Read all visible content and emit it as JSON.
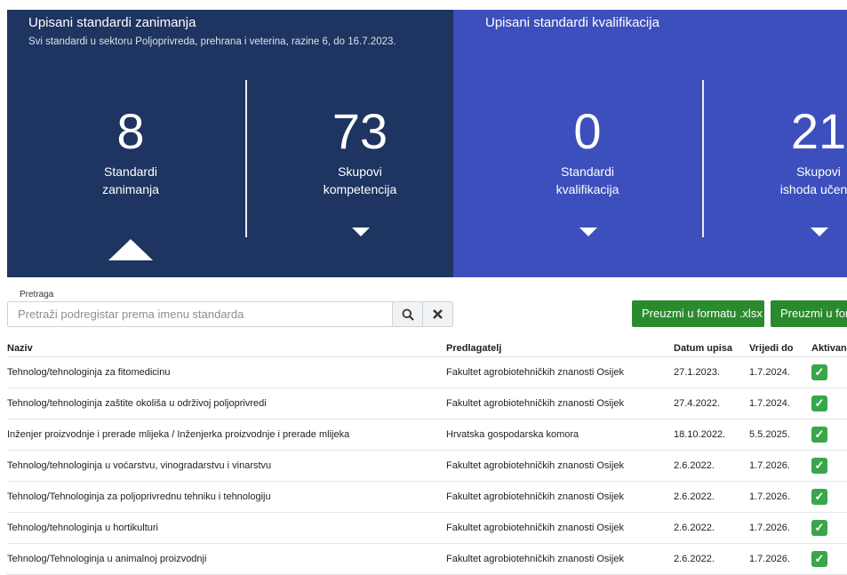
{
  "left_panel": {
    "title": "Upisani standardi zanimanja",
    "subtitle": "Svi standardi u sektoru Poljoprivreda, prehrana i veterina, razine 6, do 16.7.2023.",
    "stats": [
      {
        "value": "8",
        "label_line1": "Standardi",
        "label_line2": "zanimanja"
      },
      {
        "value": "73",
        "label_line1": "Skupovi",
        "label_line2": "kompetencija"
      }
    ]
  },
  "right_panel": {
    "title": "Upisani standardi kvalifikacija",
    "stats": [
      {
        "value": "0",
        "label_line1": "Standardi",
        "label_line2": "kvalifikacija"
      },
      {
        "value": "21",
        "label_line1": "Skupovi",
        "label_line2": "ishoda učenja"
      }
    ]
  },
  "colors": {
    "left_panel": "#1e3461",
    "right_panel": "#3d4fbd",
    "download_button": "#2b8a2e",
    "active_check": "#3aa64a"
  },
  "search": {
    "label": "Pretraga",
    "placeholder": "Pretraži podregistar prema imenu standarda",
    "search_icon": "search-icon",
    "clear_icon": "close-icon"
  },
  "downloads": {
    "xlsx_label": "Preuzmi u formatu .xlsx",
    "second_label": "Preuzmi u formatu"
  },
  "table": {
    "headers": {
      "naziv": "Naziv",
      "predlagatelj": "Predlagatelj",
      "datum": "Datum upisa",
      "vrijedi": "Vrijedi do",
      "aktivan": "Aktivan"
    },
    "rows": [
      {
        "naziv": "Tehnolog/tehnologinja za fitomedicinu",
        "predlagatelj": "Fakultet agrobiotehničkih znanosti Osijek",
        "datum": "27.1.2023.",
        "vrijedi": "1.7.2024.",
        "aktivan": "✓"
      },
      {
        "naziv": "Tehnolog/tehnologinja zaštite okoliša u održivoj poljoprivredi",
        "predlagatelj": "Fakultet agrobiotehničkih znanosti Osijek",
        "datum": "27.4.2022.",
        "vrijedi": "1.7.2024.",
        "aktivan": "✓"
      },
      {
        "naziv": "Inženjer proizvodnje i prerade mlijeka / Inženjerka proizvodnje i prerade mlijeka",
        "predlagatelj": "Hrvatska gospodarska komora",
        "datum": "18.10.2022.",
        "vrijedi": "5.5.2025.",
        "aktivan": "✓"
      },
      {
        "naziv": "Tehnolog/tehnologinja u voćarstvu, vinogradarstvu i vinarstvu",
        "predlagatelj": "Fakultet agrobiotehničkih znanosti Osijek",
        "datum": "2.6.2022.",
        "vrijedi": "1.7.2026.",
        "aktivan": "✓"
      },
      {
        "naziv": "Tehnolog/Tehnologinja za poljoprivrednu tehniku i tehnologiju",
        "predlagatelj": "Fakultet agrobiotehničkih znanosti Osijek",
        "datum": "2.6.2022.",
        "vrijedi": "1.7.2026.",
        "aktivan": "✓"
      },
      {
        "naziv": "Tehnolog/tehnologinja u hortikulturi",
        "predlagatelj": "Fakultet agrobiotehničkih znanosti Osijek",
        "datum": "2.6.2022.",
        "vrijedi": "1.7.2026.",
        "aktivan": "✓"
      },
      {
        "naziv": "Tehnolog/Tehnologinja u animalnoj proizvodnji",
        "predlagatelj": "Fakultet agrobiotehničkih znanosti Osijek",
        "datum": "2.6.2022.",
        "vrijedi": "1.7.2026.",
        "aktivan": "✓"
      }
    ]
  }
}
